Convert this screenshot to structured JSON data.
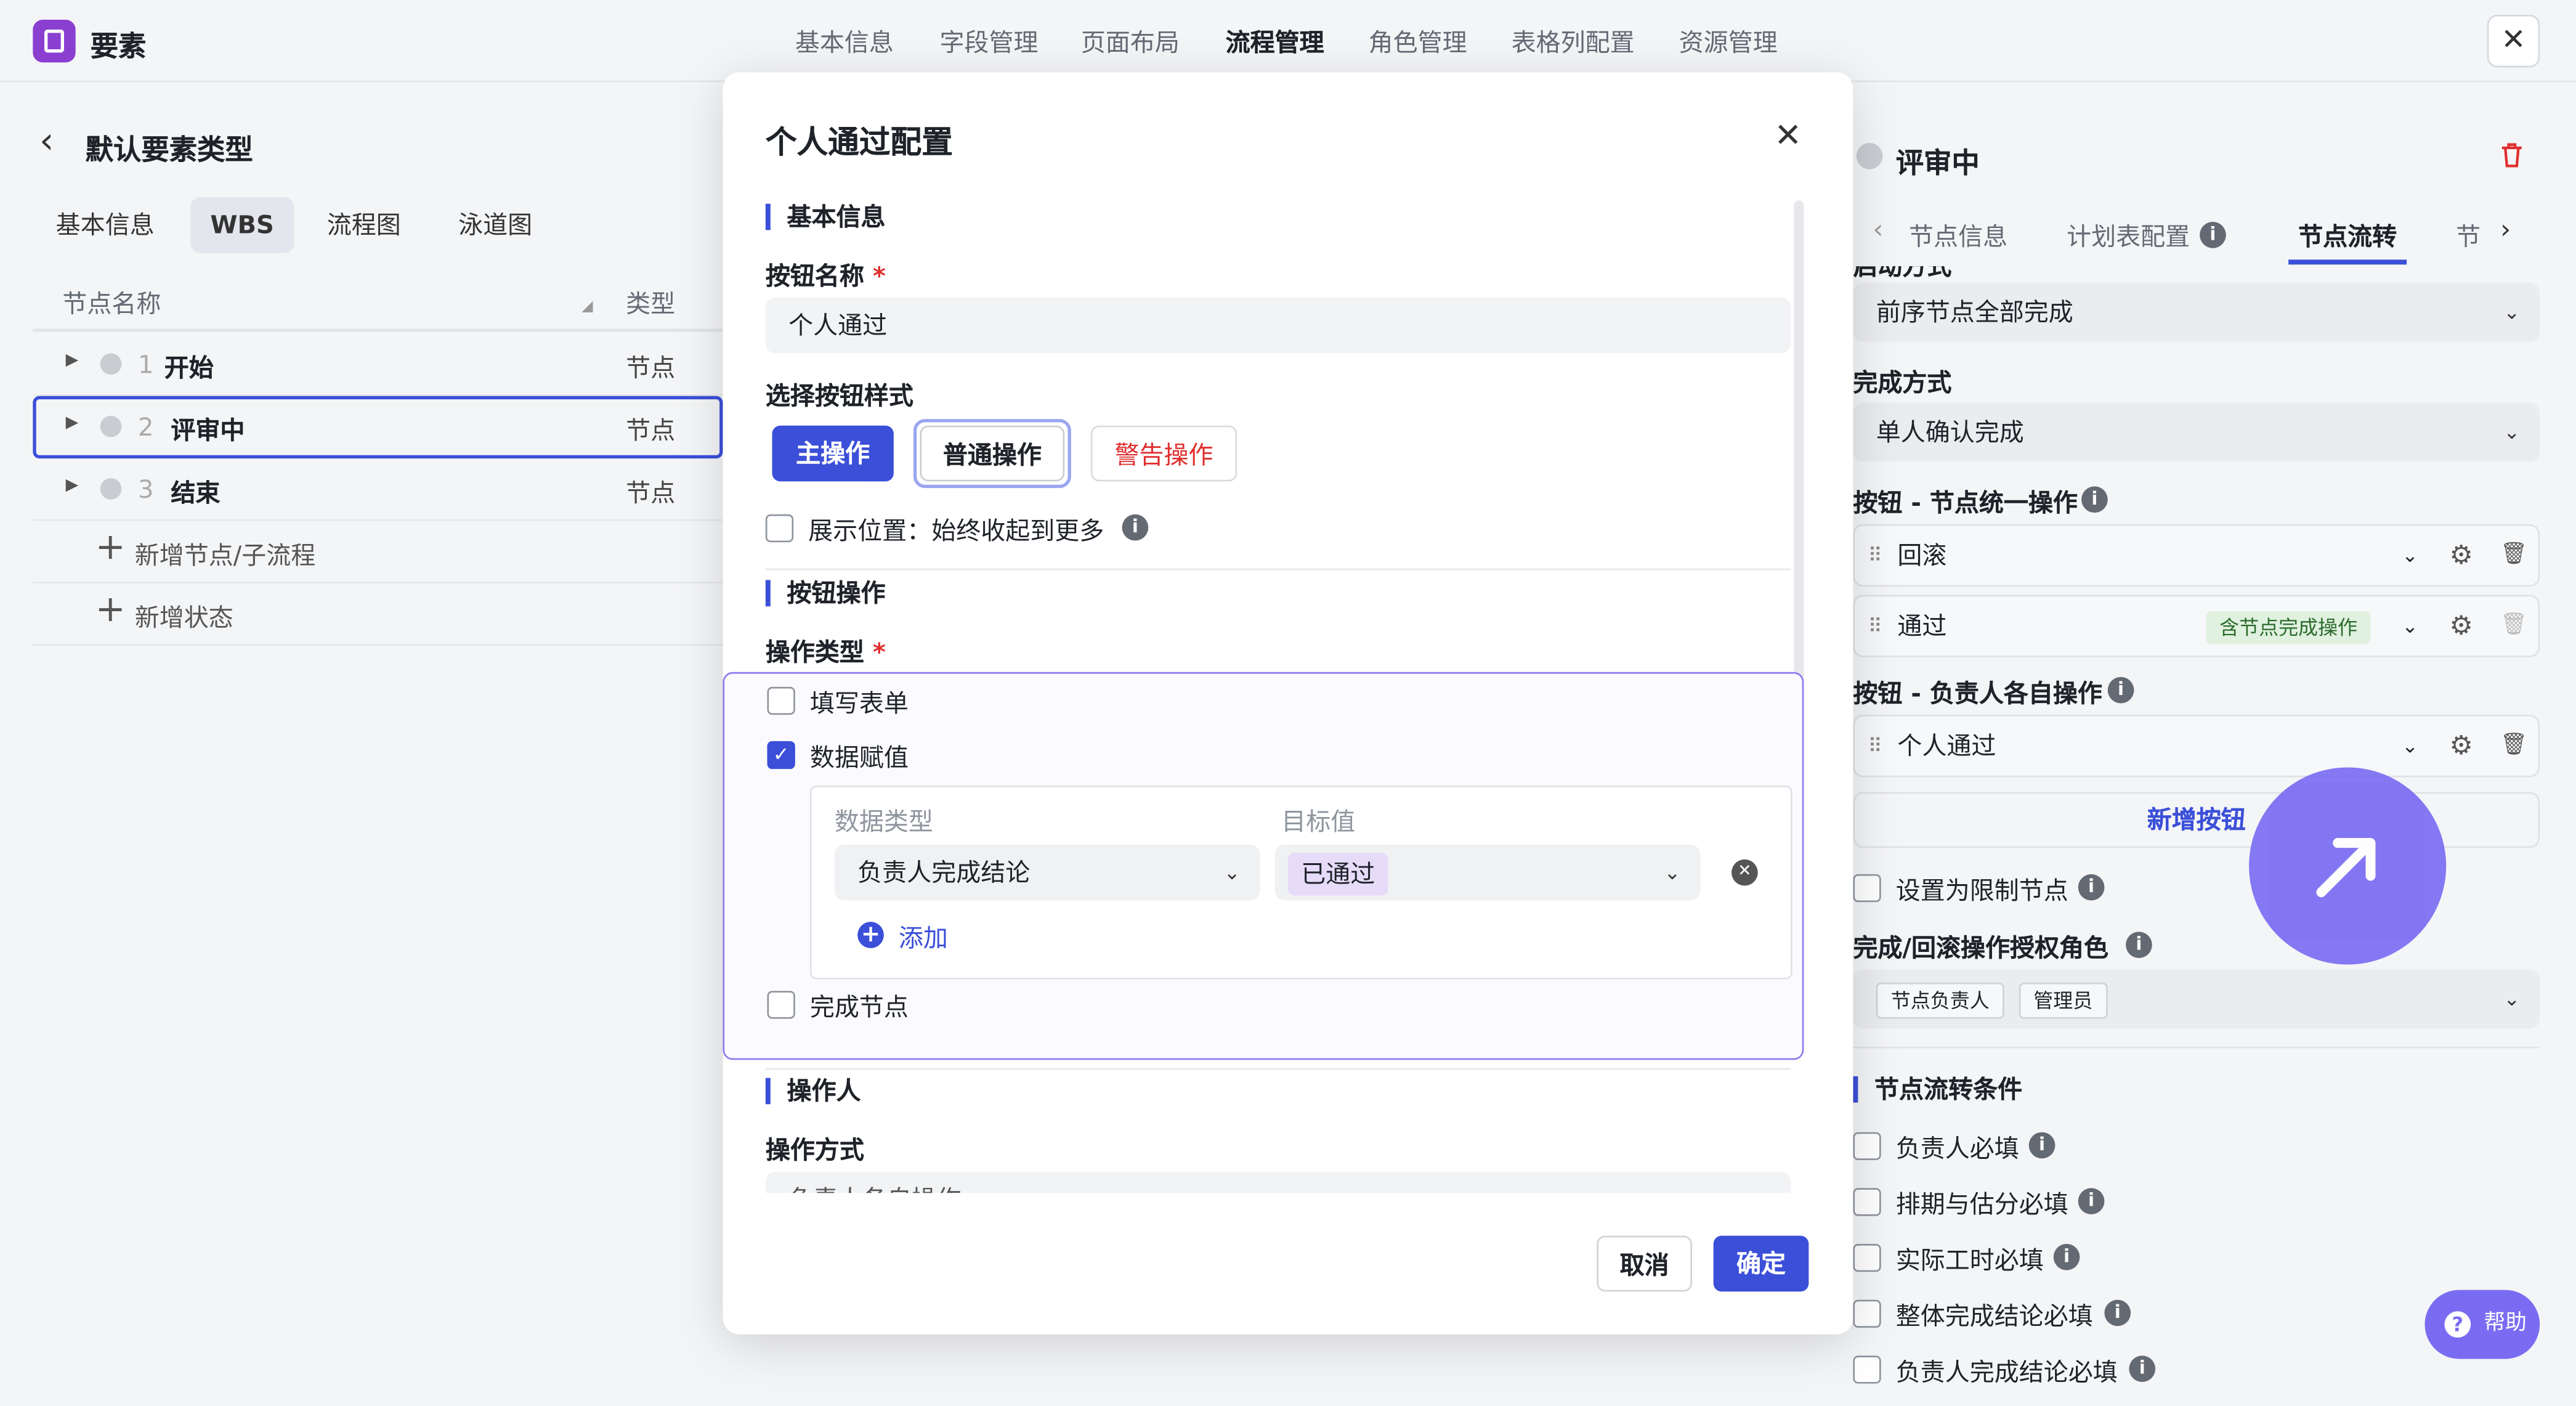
{
  "app": {
    "title": "要素",
    "close": "✕"
  },
  "nav": {
    "tabs": [
      "基本信息",
      "字段管理",
      "页面布局",
      "流程管理",
      "角色管理",
      "表格列配置",
      "资源管理"
    ],
    "active": 3
  },
  "left": {
    "back": "‹",
    "title": "默认要素类型",
    "subtabs": [
      "基本信息",
      "WBS",
      "流程图",
      "泳道图"
    ],
    "active_subtab": 1,
    "columns": [
      "节点名称",
      "类型"
    ],
    "rows": [
      {
        "num": "1",
        "name": "开始",
        "type": "节点"
      },
      {
        "num": "2",
        "name": "评审中",
        "type": "节点"
      },
      {
        "num": "3",
        "name": "结束",
        "type": "节点"
      }
    ],
    "add_node": "新增节点/子流程",
    "add_state": "新增状态"
  },
  "modal": {
    "title": "个人通过配置",
    "close": "✕",
    "sec_basic": "基本信息",
    "btn_name_label": "按钮名称",
    "req": "*",
    "btn_name_value": "个人通过",
    "style_label": "选择按钮样式",
    "styles": [
      "主操作",
      "普通操作",
      "警告操作"
    ],
    "show_pos": "展示位置：始终收起到更多",
    "info": "i",
    "sec_op": "按钮操作",
    "op_type_label": "操作类型",
    "opt_fill": "填写表单",
    "opt_assign": "数据赋值",
    "check": "✓",
    "data_type_label": "数据类型",
    "target_label": "目标值",
    "data_type_value": "负责人完成结论",
    "target_value": "已通过",
    "remove": "✕",
    "add": "添加",
    "plus": "+",
    "opt_complete": "完成节点",
    "sec_operator": "操作人",
    "op_mode_label": "操作方式",
    "op_mode_value": "负责人各自操作",
    "cancel": "取消",
    "ok": "确定"
  },
  "right": {
    "node_title": "评审中",
    "tabs": [
      "节点信息",
      "计划表配置",
      "节点流转",
      "节"
    ],
    "active_tab": 2,
    "partial_label": "启动方式",
    "start_value": "前序节点全部完成",
    "complete_label": "完成方式",
    "complete_value": "单人确认完成",
    "unified_label": "按钮 - 节点统一操作",
    "unified": [
      {
        "name": "回滚",
        "badge": ""
      },
      {
        "name": "通过",
        "badge": "含节点完成操作"
      }
    ],
    "each_label": "按钮 - 负责人各自操作",
    "each": [
      {
        "name": "个人通过"
      }
    ],
    "add_btn": "新增按钮",
    "restrict": "设置为限制节点",
    "roles_label": "完成/回滚操作授权角色",
    "roles": [
      "节点负责人",
      "管理员"
    ],
    "cond_title": "节点流转条件",
    "conds": [
      "负责人必填",
      "排期与估分必填",
      "实际工时必填",
      "整体完成结论必填",
      "负责人完成结论必填"
    ]
  },
  "help": {
    "label": "帮助",
    "icon": "?"
  },
  "colors": {
    "accent": "#3b4fd8",
    "danger": "#e02e2e",
    "fab": "#7a6cf2"
  }
}
